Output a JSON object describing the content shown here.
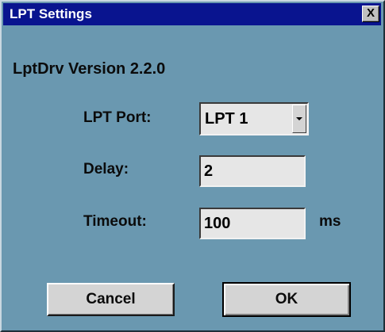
{
  "window": {
    "title": "LPT Settings",
    "close_glyph": "X"
  },
  "version_label": "LptDrv Version 2.2.0",
  "fields": {
    "lpt_port": {
      "label": "LPT Port:",
      "value": "LPT 1"
    },
    "delay": {
      "label": "Delay:",
      "value": "2"
    },
    "timeout": {
      "label": "Timeout:",
      "value": "100",
      "unit": "ms"
    }
  },
  "buttons": {
    "cancel": "Cancel",
    "ok": "OK"
  },
  "colors": {
    "dialog_background": "#6a98b0",
    "titlebar": "#09148f",
    "title_text": "#ffffff"
  },
  "icons": {
    "close": "close-icon",
    "dropdown": "chevron-down-icon"
  }
}
